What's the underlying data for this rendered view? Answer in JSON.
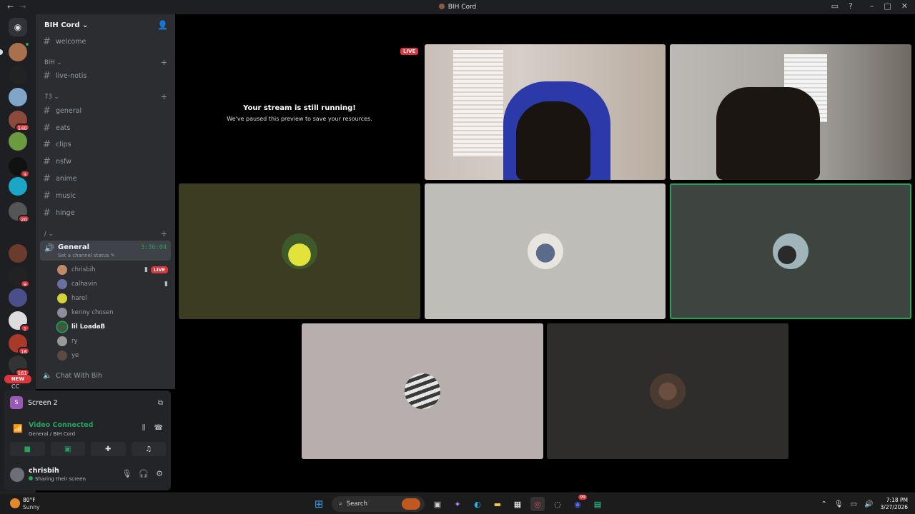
{
  "window": {
    "title": "BIH Cord"
  },
  "server": {
    "name": "BIH Cord"
  },
  "channels": {
    "welcome": "welcome",
    "cat_bih": "BIH",
    "live_notis": "live-notis",
    "cat_73": "73",
    "general": "general",
    "eats": "eats",
    "clips": "clips",
    "nsfw": "nsfw",
    "anime": "anime",
    "music": "music",
    "hinge": "hinge",
    "cat_slash": "/",
    "chat_with_bih": "Chat With Bih"
  },
  "voice": {
    "name": "General",
    "timer": "3:36:04",
    "status_placeholder": "Set a channel status",
    "users": [
      "chrisbih",
      "calhavin",
      "harel",
      "kenny chosen",
      "lil LoadaB",
      "ry",
      "ye"
    ],
    "live_label": "LIVE"
  },
  "guild_badges": [
    "140",
    "3",
    "20",
    "9",
    "1",
    "16",
    "161"
  ],
  "guild_new": "NEW",
  "guild_initials": "CC",
  "panel": {
    "screen_name": "Screen 2",
    "screen_initial": "S",
    "connected": "Video Connected",
    "location": "General / BIH Cord",
    "user_name": "chrisbih",
    "user_status": "Sharing their screen"
  },
  "stage": {
    "paused_title": "Your stream is still running!",
    "paused_sub": "We've paused this preview to save your resources.",
    "live_label": "LIVE"
  },
  "taskbar": {
    "temp": "80°F",
    "condition": "Sunny",
    "search": "Search",
    "time": "7:18 PM",
    "date": "3/27/2026",
    "discord_badge": "99"
  },
  "colors": {
    "accent_green": "#23a55a",
    "live_red": "#da373c",
    "sidebar": "#2b2d31"
  }
}
